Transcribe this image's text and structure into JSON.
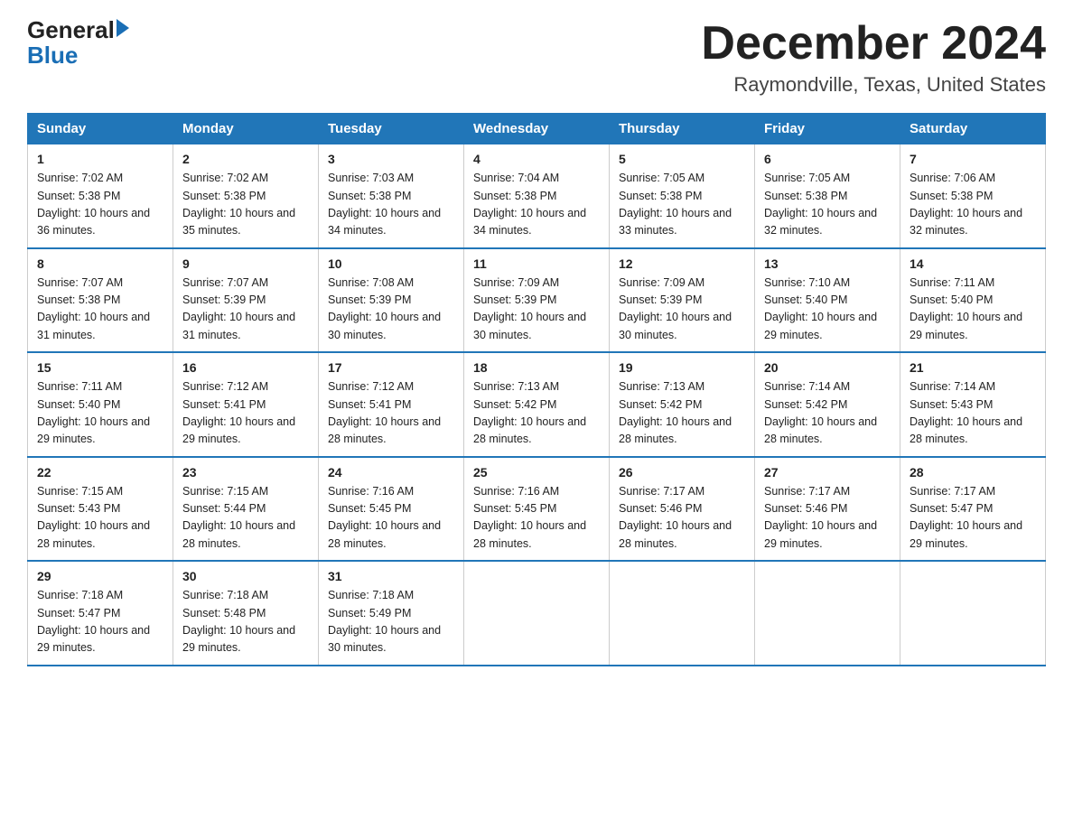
{
  "header": {
    "logo_general": "General",
    "logo_blue": "Blue",
    "month_title": "December 2024",
    "location": "Raymondville, Texas, United States"
  },
  "days_of_week": [
    "Sunday",
    "Monday",
    "Tuesday",
    "Wednesday",
    "Thursday",
    "Friday",
    "Saturday"
  ],
  "weeks": [
    [
      {
        "num": "1",
        "sunrise": "7:02 AM",
        "sunset": "5:38 PM",
        "daylight": "10 hours and 36 minutes."
      },
      {
        "num": "2",
        "sunrise": "7:02 AM",
        "sunset": "5:38 PM",
        "daylight": "10 hours and 35 minutes."
      },
      {
        "num": "3",
        "sunrise": "7:03 AM",
        "sunset": "5:38 PM",
        "daylight": "10 hours and 34 minutes."
      },
      {
        "num": "4",
        "sunrise": "7:04 AM",
        "sunset": "5:38 PM",
        "daylight": "10 hours and 34 minutes."
      },
      {
        "num": "5",
        "sunrise": "7:05 AM",
        "sunset": "5:38 PM",
        "daylight": "10 hours and 33 minutes."
      },
      {
        "num": "6",
        "sunrise": "7:05 AM",
        "sunset": "5:38 PM",
        "daylight": "10 hours and 32 minutes."
      },
      {
        "num": "7",
        "sunrise": "7:06 AM",
        "sunset": "5:38 PM",
        "daylight": "10 hours and 32 minutes."
      }
    ],
    [
      {
        "num": "8",
        "sunrise": "7:07 AM",
        "sunset": "5:38 PM",
        "daylight": "10 hours and 31 minutes."
      },
      {
        "num": "9",
        "sunrise": "7:07 AM",
        "sunset": "5:39 PM",
        "daylight": "10 hours and 31 minutes."
      },
      {
        "num": "10",
        "sunrise": "7:08 AM",
        "sunset": "5:39 PM",
        "daylight": "10 hours and 30 minutes."
      },
      {
        "num": "11",
        "sunrise": "7:09 AM",
        "sunset": "5:39 PM",
        "daylight": "10 hours and 30 minutes."
      },
      {
        "num": "12",
        "sunrise": "7:09 AM",
        "sunset": "5:39 PM",
        "daylight": "10 hours and 30 minutes."
      },
      {
        "num": "13",
        "sunrise": "7:10 AM",
        "sunset": "5:40 PM",
        "daylight": "10 hours and 29 minutes."
      },
      {
        "num": "14",
        "sunrise": "7:11 AM",
        "sunset": "5:40 PM",
        "daylight": "10 hours and 29 minutes."
      }
    ],
    [
      {
        "num": "15",
        "sunrise": "7:11 AM",
        "sunset": "5:40 PM",
        "daylight": "10 hours and 29 minutes."
      },
      {
        "num": "16",
        "sunrise": "7:12 AM",
        "sunset": "5:41 PM",
        "daylight": "10 hours and 29 minutes."
      },
      {
        "num": "17",
        "sunrise": "7:12 AM",
        "sunset": "5:41 PM",
        "daylight": "10 hours and 28 minutes."
      },
      {
        "num": "18",
        "sunrise": "7:13 AM",
        "sunset": "5:42 PM",
        "daylight": "10 hours and 28 minutes."
      },
      {
        "num": "19",
        "sunrise": "7:13 AM",
        "sunset": "5:42 PM",
        "daylight": "10 hours and 28 minutes."
      },
      {
        "num": "20",
        "sunrise": "7:14 AM",
        "sunset": "5:42 PM",
        "daylight": "10 hours and 28 minutes."
      },
      {
        "num": "21",
        "sunrise": "7:14 AM",
        "sunset": "5:43 PM",
        "daylight": "10 hours and 28 minutes."
      }
    ],
    [
      {
        "num": "22",
        "sunrise": "7:15 AM",
        "sunset": "5:43 PM",
        "daylight": "10 hours and 28 minutes."
      },
      {
        "num": "23",
        "sunrise": "7:15 AM",
        "sunset": "5:44 PM",
        "daylight": "10 hours and 28 minutes."
      },
      {
        "num": "24",
        "sunrise": "7:16 AM",
        "sunset": "5:45 PM",
        "daylight": "10 hours and 28 minutes."
      },
      {
        "num": "25",
        "sunrise": "7:16 AM",
        "sunset": "5:45 PM",
        "daylight": "10 hours and 28 minutes."
      },
      {
        "num": "26",
        "sunrise": "7:17 AM",
        "sunset": "5:46 PM",
        "daylight": "10 hours and 28 minutes."
      },
      {
        "num": "27",
        "sunrise": "7:17 AM",
        "sunset": "5:46 PM",
        "daylight": "10 hours and 29 minutes."
      },
      {
        "num": "28",
        "sunrise": "7:17 AM",
        "sunset": "5:47 PM",
        "daylight": "10 hours and 29 minutes."
      }
    ],
    [
      {
        "num": "29",
        "sunrise": "7:18 AM",
        "sunset": "5:47 PM",
        "daylight": "10 hours and 29 minutes."
      },
      {
        "num": "30",
        "sunrise": "7:18 AM",
        "sunset": "5:48 PM",
        "daylight": "10 hours and 29 minutes."
      },
      {
        "num": "31",
        "sunrise": "7:18 AM",
        "sunset": "5:49 PM",
        "daylight": "10 hours and 30 minutes."
      },
      null,
      null,
      null,
      null
    ]
  ]
}
